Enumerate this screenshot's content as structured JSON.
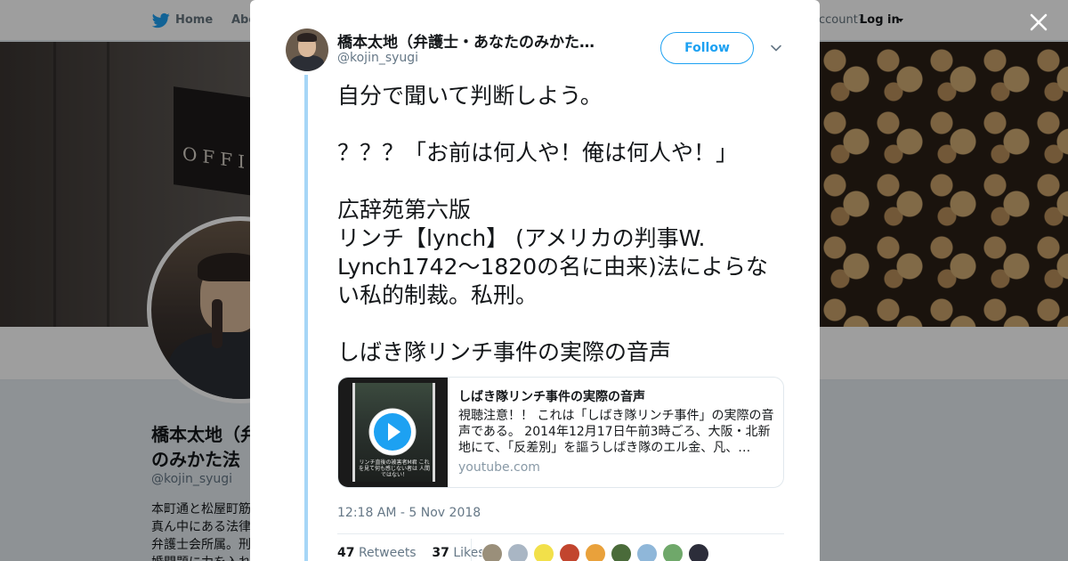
{
  "nav": {
    "home": "Home",
    "about": "Abo",
    "account_prompt": "ccount?",
    "login": "Log in"
  },
  "profile": {
    "name": "橋本太地（弁護士・あなたのみかた法律事務所）",
    "name_visible_1": "橋本太地（弁",
    "name_visible_2": "のみかた法",
    "handle": "@kojin_syugi",
    "bio_lines": [
      "本町通と松屋町筋",
      "真ん中にある法律",
      "弁護士会所属。刑",
      "婚問題に力を入れ"
    ]
  },
  "header_sign": "OFFIC",
  "tweet": {
    "author_name": "橋本太地（弁護士・あなたのみかた…",
    "author_handle": "@kojin_syugi",
    "follow_label": "Follow",
    "text": "自分で聞いて判断しよう。\n\n？？？「お前は何人や！俺は何人や！」\n\n広辞苑第六版\nリンチ【lynch】 (アメリカの判事W. Lynch1742～1820の名に由来)法によらない私的制裁。私刑。\n\nしばき隊リンチ事件の実際の音声",
    "card": {
      "title": "しばき隊リンチ事件の実際の音声",
      "description": "視聴注意！！ これは「しばき隊リンチ事件」の実際の音声である。 2014年12月17日午前3時ごろ、大阪・北新地にて、「反差別」を謳うしばき隊のエル金、凡、…",
      "domain": "youtube.com",
      "thumb_caption": "リンチ直後の被害者M君 これを見て何も感じない者は 人間ではない！"
    },
    "timestamp": "12:18 AM - 5 Nov 2018",
    "retweets_count": "47",
    "retweets_label": "Retweets",
    "likes_count": "37",
    "likes_label": "Likes"
  },
  "colors": {
    "accent": "#1da1f2",
    "thread_line": "#a6d6f7",
    "text": "#14171a",
    "muted": "#657786"
  },
  "icons": [
    "twitter-bird-icon",
    "close-icon",
    "chevron-down-icon",
    "play-icon"
  ]
}
